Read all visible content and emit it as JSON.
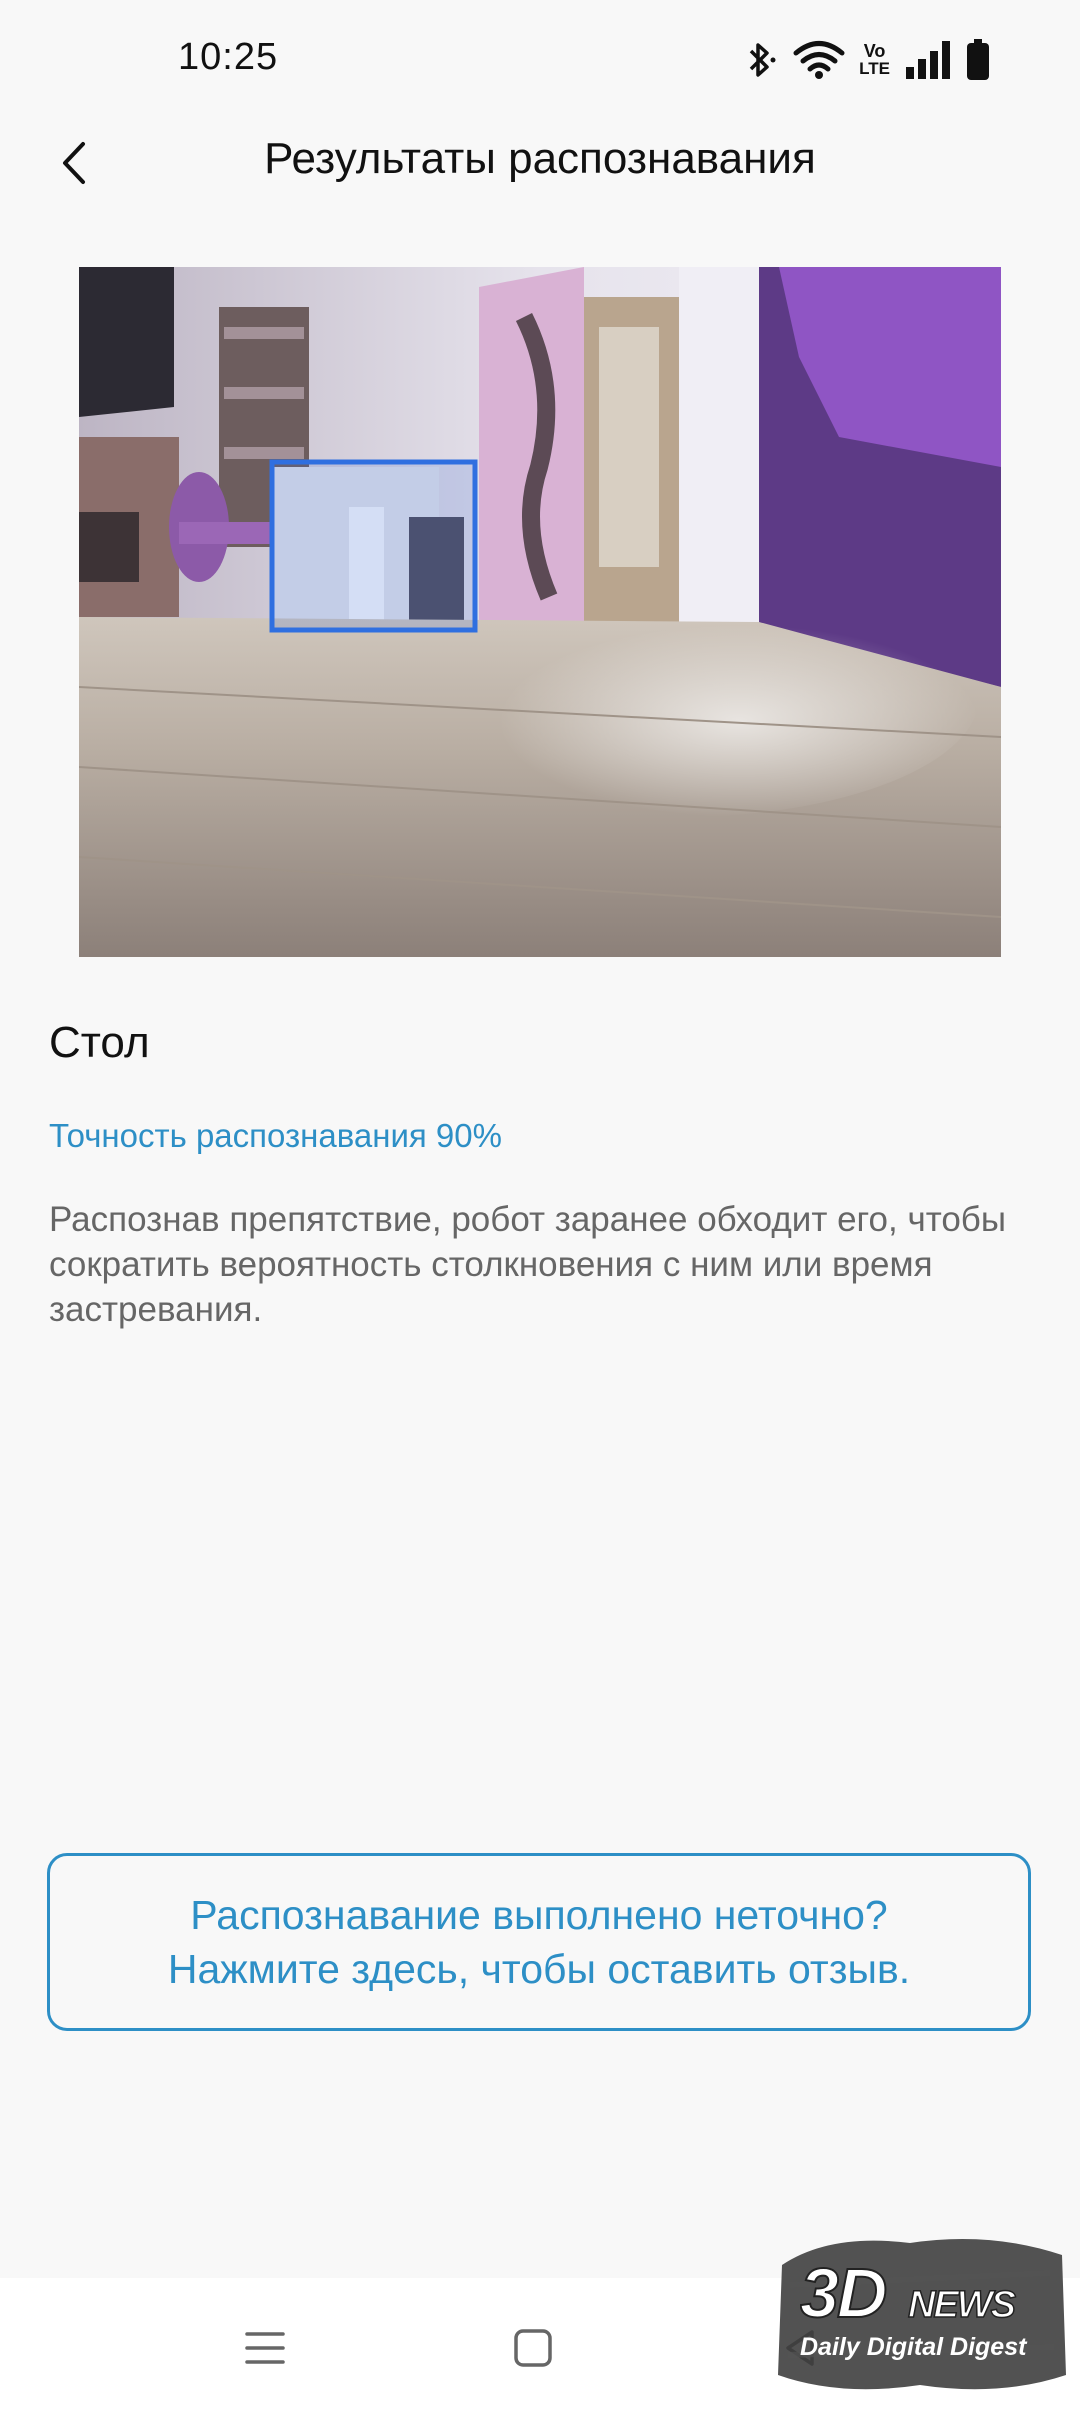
{
  "status_bar": {
    "time": "10:25",
    "icons": [
      "bluetooth-icon",
      "wifi-icon",
      "volte-icon",
      "signal-icon",
      "battery-icon"
    ],
    "volte_text_top": "Vo",
    "volte_text_bottom": "LTE"
  },
  "header": {
    "title": "Результаты распознавания",
    "back_icon": "chevron-left-icon"
  },
  "result": {
    "object_name": "Стол",
    "accuracy": "Точность распознавания 90%",
    "accuracy_value": 0.9,
    "description": "Распознав препятствие, робот заранее обходит его, чтобы сократить вероятность столкновения с ним или время застревания."
  },
  "feedback": {
    "line1": "Распознавание выполнено неточно?",
    "line2": "Нажмите здесь, чтобы оставить отзыв."
  },
  "nav_bar": {
    "icons": [
      "menu-icon",
      "home-icon",
      "back-icon"
    ]
  },
  "watermark": {
    "logo": "3DNEWS",
    "tagline": "Daily Digital Digest"
  },
  "colors": {
    "accent": "#2d8fc6",
    "background": "#f8f8f8",
    "detection_box": "#2f6fe0"
  }
}
